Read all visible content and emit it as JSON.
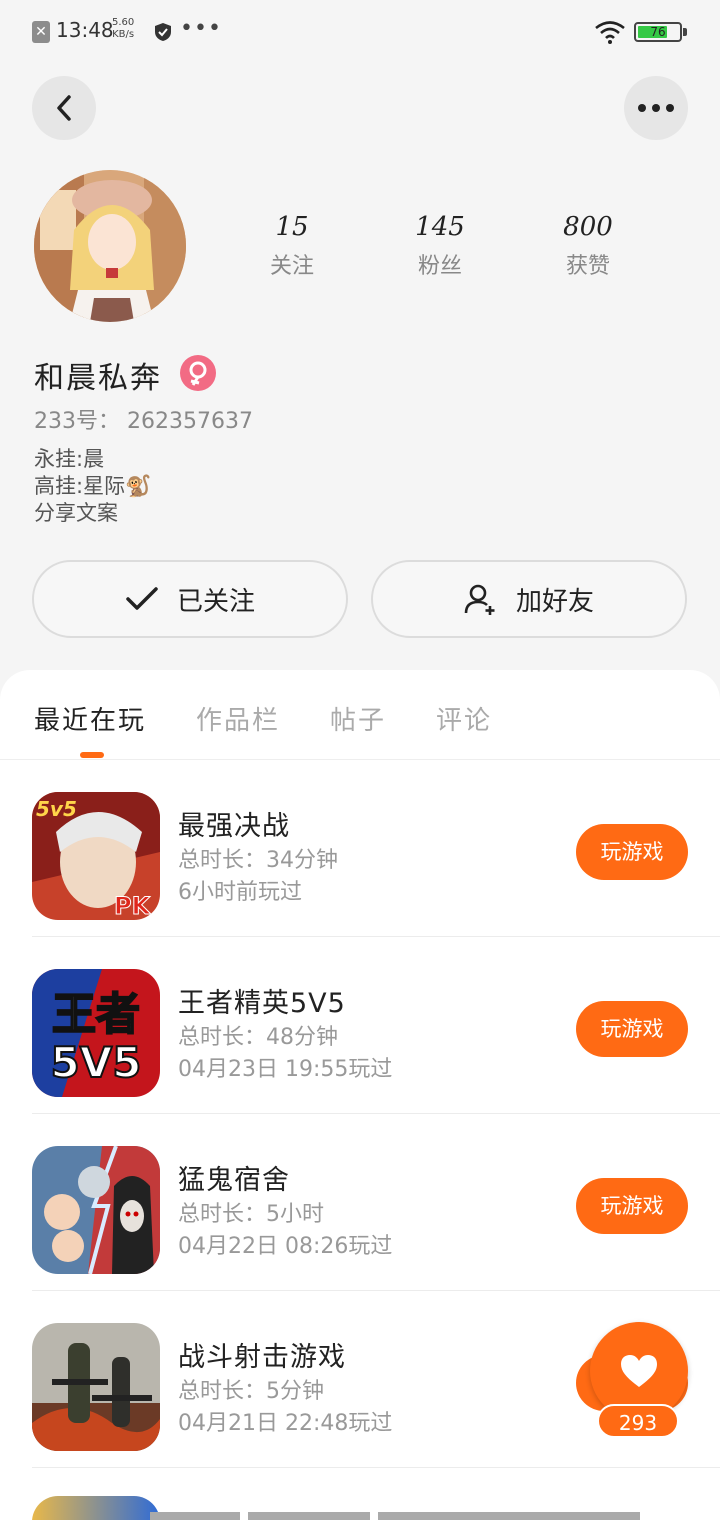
{
  "status_bar": {
    "time": "13:48",
    "net_speed_value": "5.60",
    "net_speed_unit": "KB/s",
    "battery": "76",
    "battery_level": 0.76
  },
  "profile": {
    "stats": [
      {
        "value": "15",
        "label": "关注"
      },
      {
        "value": "145",
        "label": "粉丝"
      },
      {
        "value": "800",
        "label": "获赞"
      }
    ],
    "name": "和晨私奔",
    "uid_label": "233号：",
    "uid": "262357637",
    "bio_lines": [
      "永挂:晨",
      "高挂:星际🐒",
      "分享文案"
    ]
  },
  "actions": {
    "follow_label": "已关注",
    "add_friend_label": "加好友"
  },
  "tabs": [
    {
      "label": "最近在玩",
      "active": true
    },
    {
      "label": "作品栏",
      "active": false
    },
    {
      "label": "帖子",
      "active": false
    },
    {
      "label": "评论",
      "active": false
    }
  ],
  "games": [
    {
      "name": "最强决战",
      "duration": "总时长：34分钟",
      "last_played": "6小时前玩过",
      "button": "玩游戏",
      "icon": "pk-game-icon"
    },
    {
      "name": "王者精英5V5",
      "duration": "总时长：48分钟",
      "last_played": "04月23日 19:55玩过",
      "button": "玩游戏",
      "icon": "wangzhe-5v5-icon",
      "icon_text_top": "王者",
      "icon_text_bottom": "5V5"
    },
    {
      "name": "猛鬼宿舍",
      "duration": "总时长：5小时",
      "last_played": "04月22日 08:26玩过",
      "button": "玩游戏",
      "icon": "ghost-dorm-icon"
    },
    {
      "name": "战斗射击游戏",
      "duration": "总时长：5分钟",
      "last_played": "04月21日 22:48玩过",
      "button": "玩游戏",
      "icon": "shooter-game-icon"
    }
  ],
  "like": {
    "count": "293"
  },
  "colors": {
    "accent": "#ff6a14",
    "gender": "#f26b84"
  }
}
